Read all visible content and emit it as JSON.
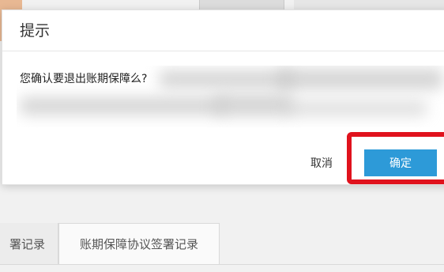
{
  "background": {
    "tabs": [
      {
        "label": "署记录"
      },
      {
        "label": "账期保障协议签署记录"
      }
    ]
  },
  "dialog": {
    "title": "提示",
    "message": "您确认要退出账期保障么?",
    "cancel_label": "取消",
    "confirm_label": "确定"
  },
  "colors": {
    "confirm_button": "#2d9ad8",
    "highlight_border": "#e0121d",
    "corner_accent": "#e8b893"
  }
}
